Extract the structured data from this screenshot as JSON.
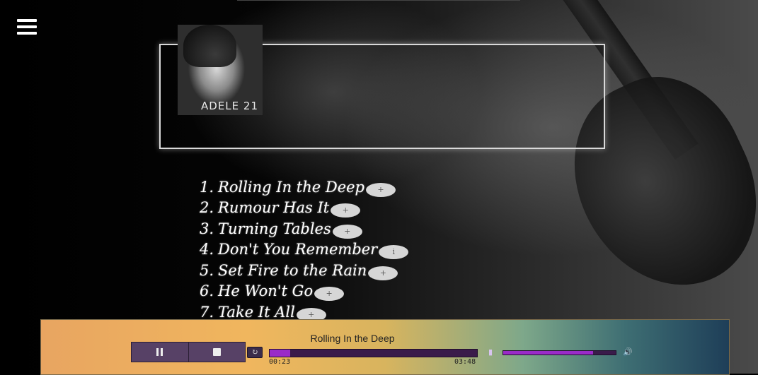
{
  "album": {
    "cover_text": "ADELE 21"
  },
  "tracks": [
    {
      "num": "1.",
      "title": "Rolling In the Deep",
      "add_label": "+"
    },
    {
      "num": "2.",
      "title": "Rumour Has It",
      "add_label": "+"
    },
    {
      "num": "3.",
      "title": "Turning Tables",
      "add_label": "+"
    },
    {
      "num": "4.",
      "title": "Don't You Remember",
      "add_label": "i"
    },
    {
      "num": "5.",
      "title": "Set Fire to the Rain",
      "add_label": "+"
    },
    {
      "num": "6.",
      "title": "He Won't Go",
      "add_label": "+"
    },
    {
      "num": "7.",
      "title": "Take It All",
      "add_label": "+"
    }
  ],
  "player": {
    "now_playing": "Rolling In the Deep",
    "current_time": "00:23",
    "total_time": "03:48",
    "progress": 0.1,
    "volume": 0.8
  },
  "icons": {
    "menu": "hamburger-icon",
    "pause": "pause-icon",
    "stop": "stop-icon",
    "loop": "loop-icon",
    "volume_low": "volume-low-icon",
    "volume_high": "volume-high-icon"
  },
  "colors": {
    "accent": "#9a2bc8",
    "control_bg": "#574166"
  }
}
